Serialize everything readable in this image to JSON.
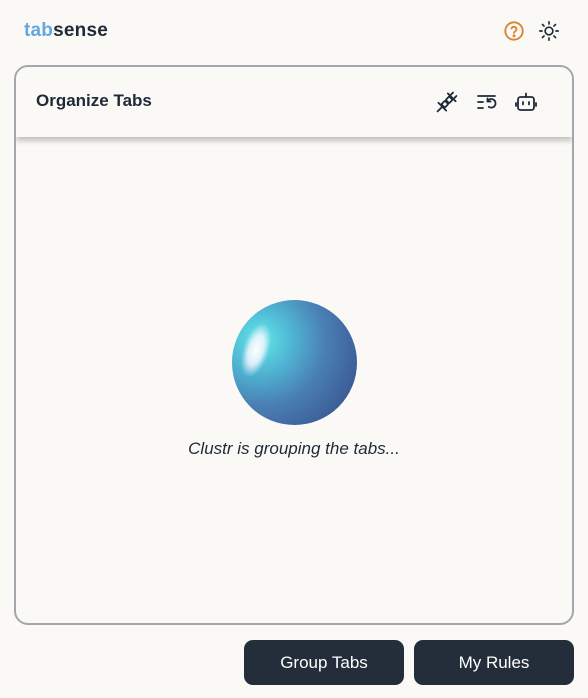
{
  "app": {
    "logo_part1": "tab",
    "logo_part2": "sense",
    "accent_color": "#62a8e0",
    "help_icon_color": "#d9832e"
  },
  "topbar": {
    "icons": [
      "help-circle-icon",
      "sun-icon"
    ]
  },
  "panel": {
    "title": "Organize Tabs",
    "header_icons": [
      "plug-icon",
      "list-reorder-icon",
      "robot-icon"
    ],
    "status_text": "Clustr is grouping the tabs..."
  },
  "actions": {
    "group_tabs_label": "Group Tabs",
    "my_rules_label": "My Rules",
    "button_color": "#242d3a"
  }
}
